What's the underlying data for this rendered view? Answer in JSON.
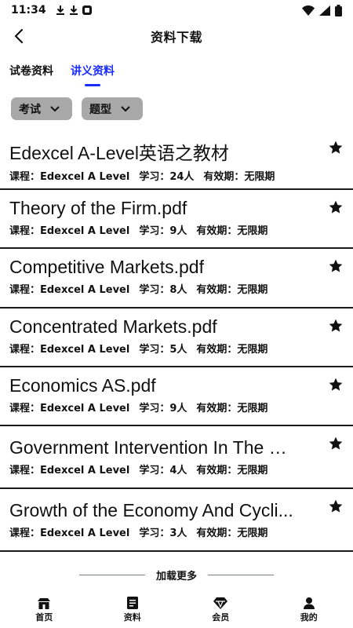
{
  "status_bar": {
    "time": "11:34"
  },
  "header": {
    "title": "资料下载"
  },
  "tabs": [
    {
      "label": "试卷资料"
    },
    {
      "label": "讲义资料"
    }
  ],
  "filters": [
    {
      "label": "考试"
    },
    {
      "label": "题型"
    }
  ],
  "items": [
    {
      "title": "Edexcel A-Level英语之教材",
      "course": "课程：Edexcel A Level",
      "study": "学习：24人",
      "validity": "有效期：无限期"
    },
    {
      "title": "Theory of the Firm.pdf",
      "course": "课程：Edexcel A Level",
      "study": "学习：9人",
      "validity": "有效期：无限期"
    },
    {
      "title": "Competitive Markets.pdf",
      "course": "课程：Edexcel A Level",
      "study": "学习：8人",
      "validity": "有效期：无限期"
    },
    {
      "title": "Concentrated Markets.pdf",
      "course": "课程：Edexcel A Level",
      "study": "学习：5人",
      "validity": "有效期：无限期"
    },
    {
      "title": "Economics AS.pdf",
      "course": "课程：Edexcel A Level",
      "study": "学习：9人",
      "validity": "有效期：无限期"
    },
    {
      "title": "Government Intervention In The M...",
      "course": "课程：Edexcel A Level",
      "study": "学习：4人",
      "validity": "有效期：无限期"
    },
    {
      "title": "Growth of the Economy And Cycli...",
      "course": "课程：Edexcel A Level",
      "study": "学习：3人",
      "validity": "有效期：无限期"
    }
  ],
  "load_more": {
    "label": "加载更多"
  },
  "bottom_nav": [
    {
      "label": "首页",
      "icon": "home-icon"
    },
    {
      "label": "资料",
      "icon": "document-icon"
    },
    {
      "label": "会员",
      "icon": "diamond-icon"
    },
    {
      "label": "我的",
      "icon": "user-icon"
    }
  ],
  "colors": {
    "accent": "#1a2cff",
    "filter_bg": "#a8a8a8",
    "divider": "#1b1b1b"
  }
}
